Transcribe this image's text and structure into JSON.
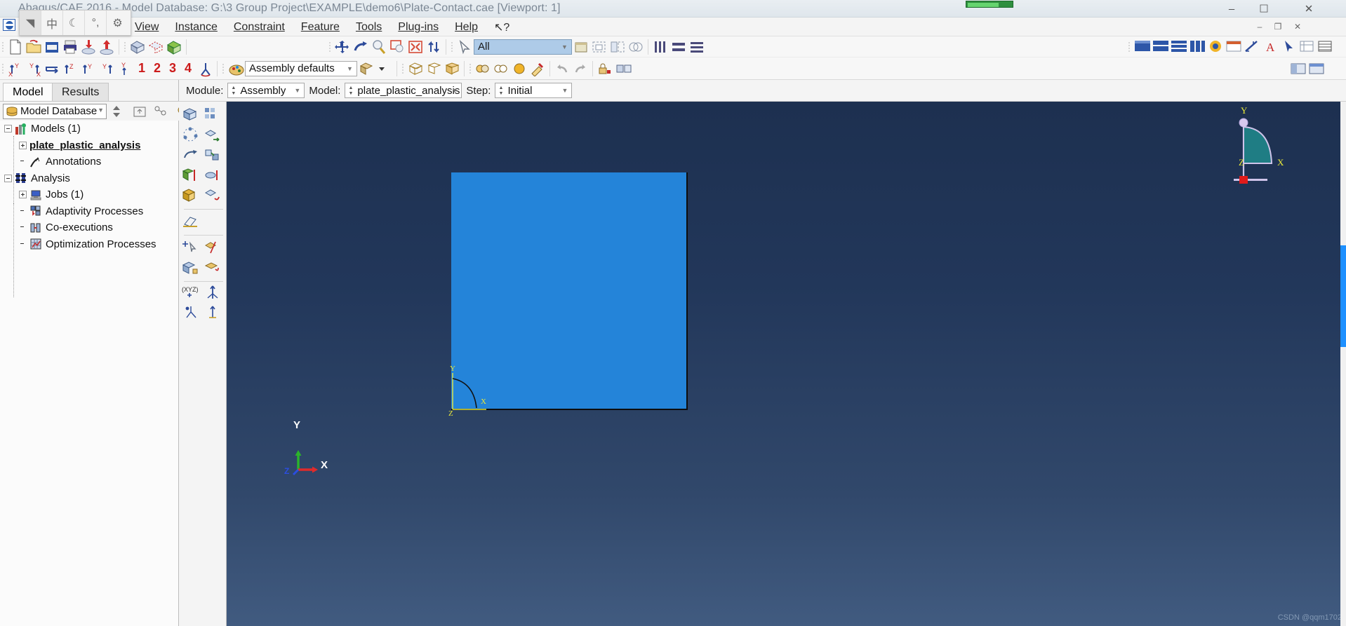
{
  "window": {
    "title": "Abaqus/CAE 2016 - Model Database: G:\\3 Group Project\\EXAMPLE\\demo6\\Plate-Contact.cae [Viewport: 1]",
    "minimize": "–",
    "maximize": "☐",
    "close": "✕",
    "restore_inner": "–",
    "maximize_inner": "❐",
    "close_inner": "✕"
  },
  "ime": {
    "items": [
      {
        "name": "ime-pen-icon",
        "glyph": "◥"
      },
      {
        "name": "ime-chinese-mode-icon",
        "glyph": "中"
      },
      {
        "name": "ime-moon-icon",
        "glyph": "☾"
      },
      {
        "name": "ime-punctuation-icon",
        "glyph": "°,"
      },
      {
        "name": "ime-settings-icon",
        "glyph": "⚙"
      }
    ]
  },
  "menubar": {
    "items": [
      {
        "label": "View",
        "mnemonic": "V"
      },
      {
        "label": "Instance",
        "mnemonic": "I"
      },
      {
        "label": "Constraint",
        "mnemonic": "o"
      },
      {
        "label": "Feature",
        "mnemonic": "u"
      },
      {
        "label": "Tools",
        "mnemonic": "T"
      },
      {
        "label": "Plug-ins",
        "mnemonic": "g"
      },
      {
        "label": "Help",
        "mnemonic": "H"
      }
    ],
    "help_cursor": "↖?"
  },
  "toolbar_file": {
    "icons": [
      "new-file-icon",
      "open-file-icon",
      "save-model-database-icon",
      "print-icon",
      "import-icon",
      "export-icon"
    ],
    "mesh_icons": [
      "mesh-part-icon",
      "mesh-seed-icon",
      "mesh-verify-icon"
    ]
  },
  "toolbar_view": {
    "icons": [
      "pan-view-icon",
      "rotate-view-icon",
      "magnify-view-icon",
      "box-zoom-view-icon",
      "auto-fit-view-icon",
      "cycle-views-icon",
      "selection-arrow-icon"
    ],
    "filter_combo_value": "All",
    "extra_icons": [
      "viewport-icon",
      "render-shaded-icon",
      "render-hidden-icon",
      "render-wire-icon"
    ],
    "right_icons": [
      "display-group-all-icon",
      "display-group-replace-icon",
      "display-group-remove-icon",
      "column-layout-icon",
      "query-icon",
      "annotate-text-icon",
      "probe-icon",
      "measure-icon",
      "text-annotation-icon",
      "arrow-pointer-icon",
      "list-icon",
      "table-icon"
    ],
    "ruler_icons": [
      "ruler1-icon",
      "ruler2-icon",
      "ruler3-icon"
    ]
  },
  "toolbar_views": {
    "orientation_icons": [
      "view-xy-icon",
      "view-yx-icon",
      "view-rotate-icon",
      "view-z-icon",
      "view-y-icon",
      "view-yz-icon",
      "view-apply-icon"
    ],
    "saved_views": [
      "1",
      "2",
      "3",
      "4"
    ],
    "custom_view_icon": "custom-view-icon",
    "color_code_icon": "color-code-icon",
    "color_combo_value": "Assembly defaults",
    "color_dropdown_icon": "color-mode-icon",
    "display_icons": [
      "shaded-icon",
      "wireframe-icon",
      "filled-icon"
    ],
    "ctx_icons": [
      "create-constraint-icon",
      "create-set-icon",
      "create-surface-icon",
      "color-picker-icon"
    ],
    "undo_icon": "undo-icon",
    "redo_icon": "redo-icon",
    "lock_icons": [
      "feature-lock-icon",
      "feature-suppress-icon"
    ],
    "far_icons": [
      "module-manager-icon",
      "job-manager-icon"
    ]
  },
  "context": {
    "module_label": "Module:",
    "module_value": "Assembly",
    "model_label": "Model:",
    "model_value": "plate_plastic_analysis",
    "step_label": "Step:",
    "step_value": "Initial"
  },
  "left_panel": {
    "tabs": [
      {
        "label": "Model",
        "active": true
      },
      {
        "label": "Results",
        "active": false
      }
    ],
    "database_combo": "Model Database",
    "database_icon": "database-icon",
    "toolbar_icons": [
      "spin-up-down-icon",
      "move-up-icon",
      "filter-tree-icon",
      "bulb-icon"
    ],
    "tree": [
      {
        "label": "Models (1)",
        "indent": 0,
        "expander": "minus",
        "icon": "models-icon",
        "selected": false
      },
      {
        "label": "plate_plastic_analysis",
        "indent": 1,
        "expander": "plus",
        "icon": "",
        "selected": true
      },
      {
        "label": "Annotations",
        "indent": 1,
        "expander": "none",
        "icon": "annotations-icon",
        "selected": false
      },
      {
        "label": "Analysis",
        "indent": 0,
        "expander": "minus",
        "icon": "analysis-icon",
        "selected": false
      },
      {
        "label": "Jobs (1)",
        "indent": 1,
        "expander": "plus",
        "icon": "jobs-icon",
        "selected": false
      },
      {
        "label": "Adaptivity Processes",
        "indent": 1,
        "expander": "none",
        "icon": "adaptivity-icon",
        "selected": false
      },
      {
        "label": "Co-executions",
        "indent": 1,
        "expander": "none",
        "icon": "coexecution-icon",
        "selected": false
      },
      {
        "label": "Optimization Processes",
        "indent": 1,
        "expander": "none",
        "icon": "optimization-icon",
        "selected": false
      }
    ]
  },
  "toolbox": {
    "title": "assembly-module-toolbox",
    "rows": [
      [
        "instance-part-icon",
        "linear-pattern-icon"
      ],
      [
        "radial-pattern-icon",
        "translate-instance-icon"
      ],
      [
        "rotate-instance-icon",
        "translate-to-icon"
      ],
      [
        "constrain-face-to-face-icon",
        "constrain-axis-to-axis-icon"
      ],
      [
        "merge-cut-instances-icon",
        "convert-constraints-icon"
      ],
      [
        "create-datum-plane-icon",
        ""
      ],
      [
        "query-instance-icon",
        "partition-cell-icon"
      ],
      [
        "create-set-icon",
        "create-surface-icon"
      ],
      [
        "datum-csys-icon",
        "datum-axis-icon"
      ],
      [
        "datum-point-icon",
        "datum-plane-icon"
      ]
    ]
  },
  "viewport": {
    "part_triad": {
      "x": "X",
      "y": "Y",
      "z": "Z"
    },
    "global_triad": {
      "x": "X",
      "y": "Y",
      "z": "Z"
    },
    "rotate_widget": {
      "x": "X",
      "y": "Y",
      "z": "Z"
    },
    "watermark": "CSDN @qqm1702",
    "part_color": "#2484d9",
    "background_top": "#1d3050",
    "background_bottom": "#415b80"
  }
}
